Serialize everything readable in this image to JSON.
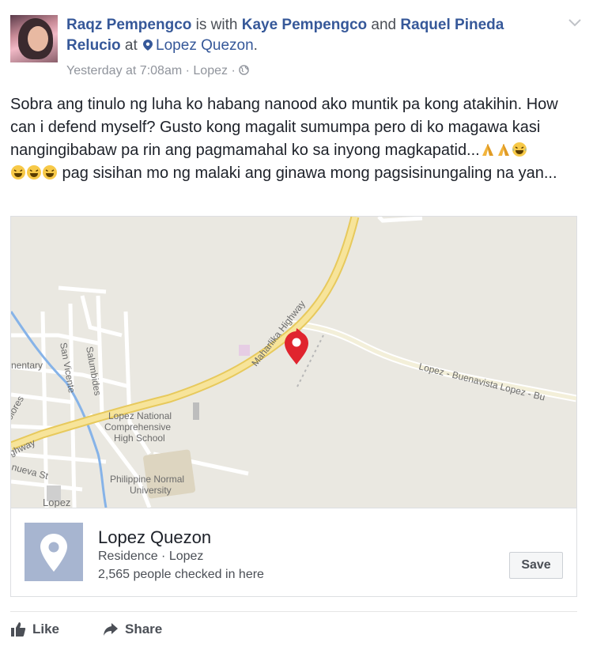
{
  "post": {
    "author": "Raqz Pempengco",
    "with_word": "is with",
    "tagged_1": "Kaye Pempengco",
    "and_word": "and",
    "tagged_2": "Raquel Pineda Relucio",
    "at_word": "at",
    "location": "Lopez Quezon",
    "period": ".",
    "timestamp": "Yesterday at 7:08am",
    "meta_place": "Lopez",
    "separator": "·",
    "body_1": "Sobra ang tinulo ng luha ko habang nanood ako muntik pa kong atakihin. How can i defend myself? Gusto kong magalit sumumpa pero di ko magawa kasi nangingibabaw pa rin ang pagmamahal ko sa inyong magkapatid...",
    "body_2": " pag sisihan mo ng malaki ang ginawa mong pagsisinungaling na yan..."
  },
  "map": {
    "labels": {
      "highway": "Maharlika Highway",
      "highway_left": "ghway",
      "road": "Lopez - Buenavista  Lopez - Bu",
      "school": [
        "Lopez National",
        "Comprehensive",
        "High School"
      ],
      "university": [
        "Philippine Normal",
        "University"
      ],
      "san_vicente": "San Vicente",
      "salumbides": "Salumbides",
      "mentary": "nentary",
      "dolores": "olores",
      "nueva": "nueva St",
      "lopez_town": "Lopez"
    }
  },
  "place": {
    "name": "Lopez Quezon",
    "category": "Residence · Lopez",
    "checkins": "2,565 people checked in here",
    "save_label": "Save"
  },
  "actions": {
    "like": "Like",
    "share": "Share"
  },
  "colors": {
    "link": "#365899",
    "pin": "#e0242e",
    "highway": "#f4dc7a",
    "map_bg": "#eae8e1"
  }
}
